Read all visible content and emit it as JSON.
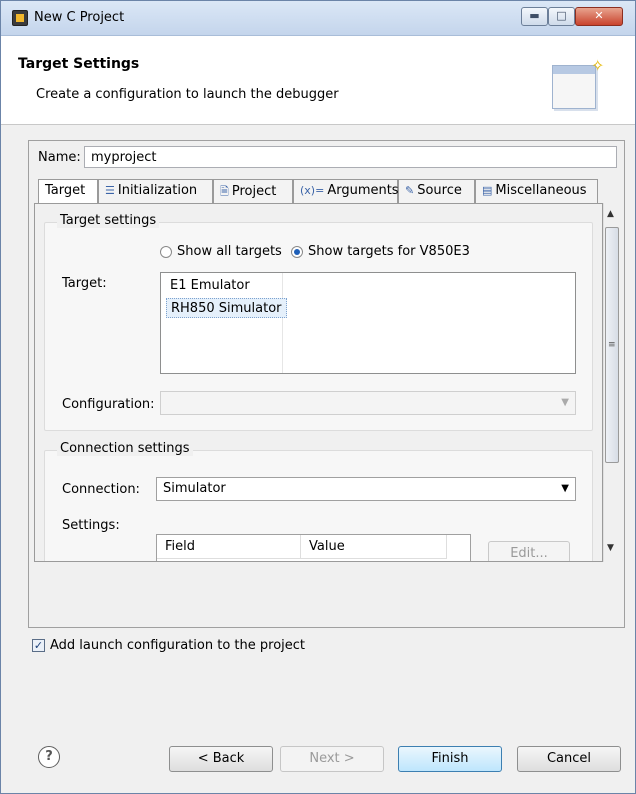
{
  "window": {
    "title": "New C Project"
  },
  "header": {
    "title": "Target Settings",
    "subtitle": "Create a configuration to launch the debugger"
  },
  "name_field": {
    "label": "Name:",
    "value": "myproject"
  },
  "tabs": [
    {
      "label": "Target",
      "icon": "target-icon",
      "active": true
    },
    {
      "label": "Initialization",
      "icon": "list-icon",
      "active": false
    },
    {
      "label": "Project",
      "icon": "document-icon",
      "active": false
    },
    {
      "label": "Arguments",
      "icon": "variable-icon",
      "active": false
    },
    {
      "label": "Source",
      "icon": "source-icon",
      "active": false
    },
    {
      "label": "Miscellaneous",
      "icon": "window-icon",
      "active": false
    }
  ],
  "target_settings": {
    "group_title": "Target settings",
    "radio_show_all": "Show all targets",
    "radio_show_device": "Show targets for V850E3",
    "selected_radio": "show_device",
    "target_label": "Target:",
    "targets": [
      "E1 Emulator",
      "RH850 Simulator"
    ],
    "selected_target": "RH850 Simulator",
    "configuration_label": "Configuration:",
    "configuration_value": ""
  },
  "connection_settings": {
    "group_title": "Connection settings",
    "connection_label": "Connection:",
    "connection_value": "Simulator",
    "settings_label": "Settings:",
    "columns": [
      "Field",
      "Value"
    ],
    "edit_button": "Edit..."
  },
  "add_launch_config": {
    "label": "Add launch configuration to the project",
    "checked": true
  },
  "buttons": {
    "back": "< Back",
    "next": "Next >",
    "finish": "Finish",
    "cancel": "Cancel"
  },
  "colors": {
    "accent": "#3c7fb1",
    "selection": "#e5f0fb"
  }
}
